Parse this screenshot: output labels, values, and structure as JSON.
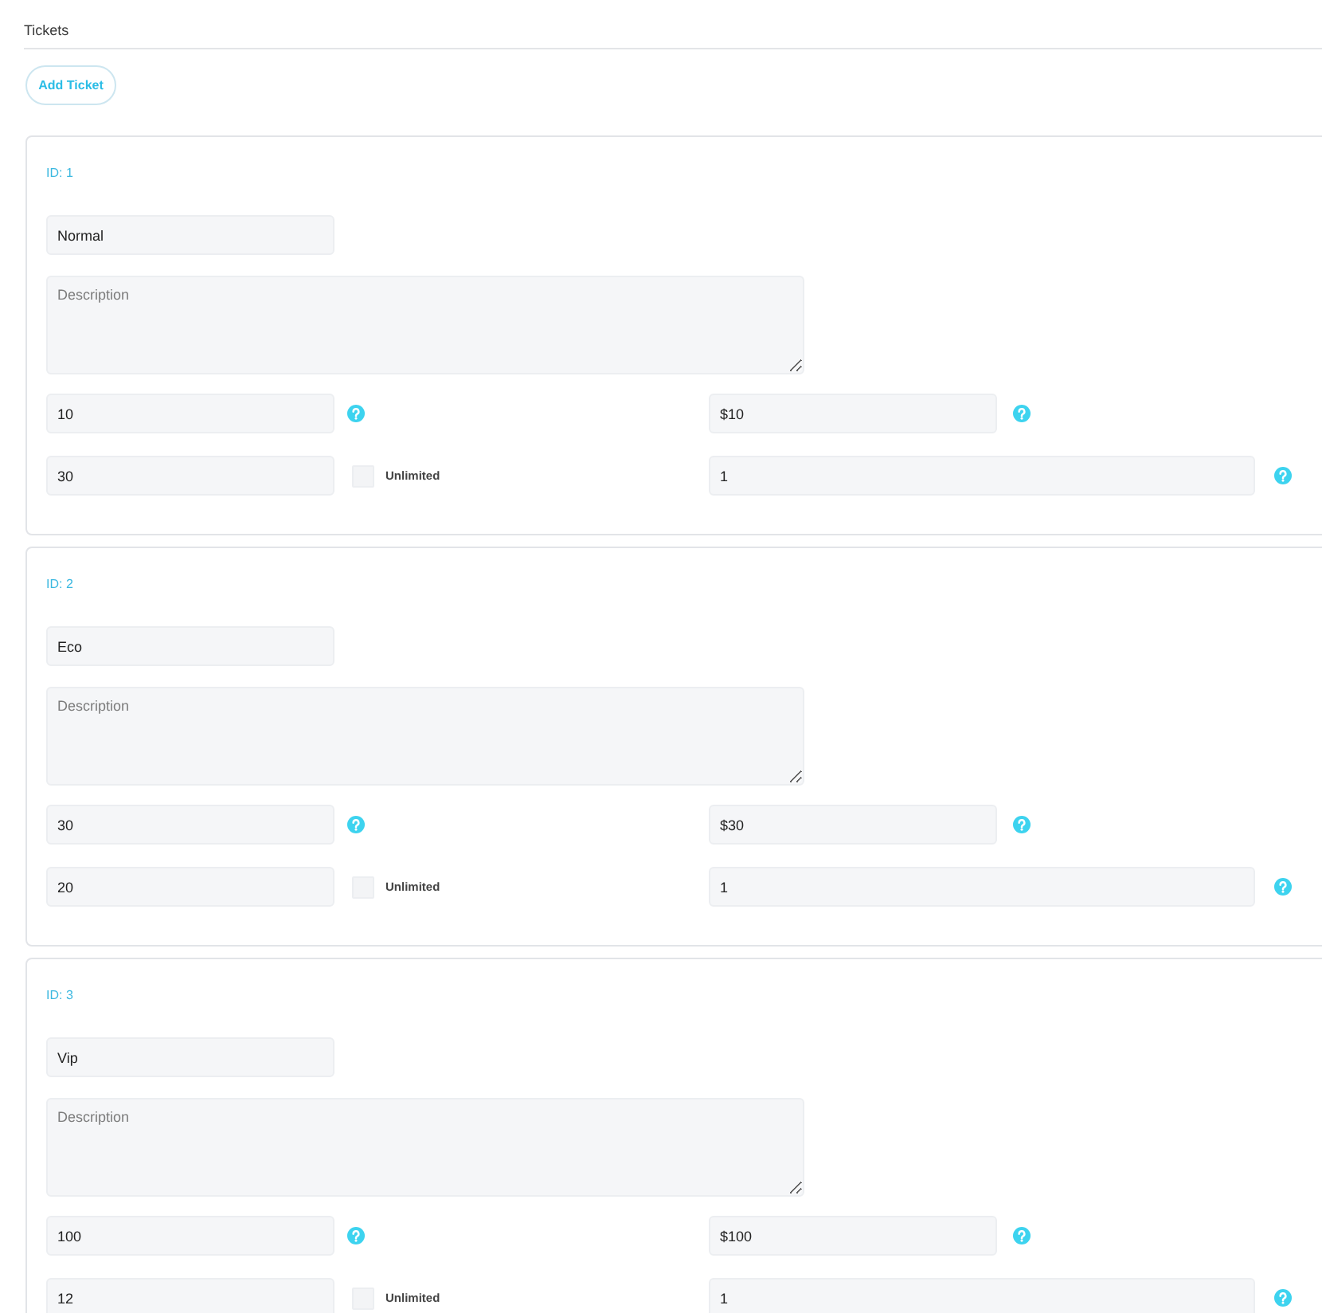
{
  "section": {
    "title": "Tickets"
  },
  "add_button": {
    "label": "Add Ticket"
  },
  "tickets": [
    {
      "id_label": "ID: 1",
      "name": {
        "value": "Normal"
      },
      "description": {
        "placeholder": "Description"
      },
      "field_1": {
        "value": "10"
      },
      "field_2": {
        "value": "$10"
      },
      "field_3": {
        "value": "30"
      },
      "unlimited": {
        "label": "Unlimited",
        "checked": false
      },
      "field_4": {
        "value": "1"
      }
    },
    {
      "id_label": "ID: 2",
      "name": {
        "value": "Eco"
      },
      "description": {
        "placeholder": "Description"
      },
      "field_1": {
        "value": "30"
      },
      "field_2": {
        "value": "$30"
      },
      "field_3": {
        "value": "20"
      },
      "unlimited": {
        "label": "Unlimited",
        "checked": false
      },
      "field_4": {
        "value": "1"
      }
    },
    {
      "id_label": "ID: 3",
      "name": {
        "value": "Vip"
      },
      "description": {
        "placeholder": "Description"
      },
      "field_1": {
        "value": "100"
      },
      "field_2": {
        "value": "$100"
      },
      "field_3": {
        "value": "12"
      },
      "unlimited": {
        "label": "Unlimited",
        "checked": false
      },
      "field_4": {
        "value": "1"
      }
    }
  ]
}
